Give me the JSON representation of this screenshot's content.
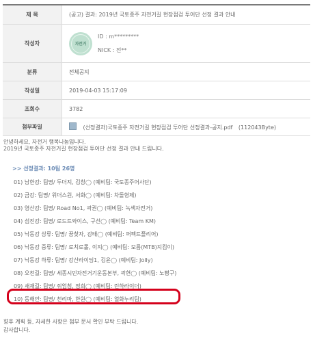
{
  "meta": {
    "title_label": "제 목",
    "title_value": "(공고) 결과: 2019년 국토종주 자전거길 현장점검 투어단 선정 결과 안내",
    "author_label": "작성자",
    "author_avatar_text": "자전거",
    "author_id": "ID : m*********",
    "author_nick": "NICK : 전**",
    "category_label": "분류",
    "category_value": "전체공지",
    "date_label": "작성일",
    "date_value": "2019-04-03 15:17:09",
    "views_label": "조회수",
    "views_value": "3782",
    "attach_label": "첨부파일",
    "attach_name": "(선정결과)국토종주 자전거길 현장점검 투어단 선정결과-공지.pdf",
    "attach_size": "(112043Byte)"
  },
  "body": {
    "greeting": "안녕하세요, 자전거 행복나눔입니다.",
    "intro": "2019년 국토종주 자전거길 현장점검 투어단 선정 결과 안내 드립니다.",
    "result_heading": ">> 선정결과: 10팀 26명",
    "items": [
      "01) 남한강: 팀명/ 두더지, 김창◯ (예비팀: 국토종주어사단)",
      "02) 금강: 팀명/ 위더스원, 서화◯ (예비팀: 차돌형제)",
      "03) 영산강: 팀명/ Road No1, 곽권◯ (예비팀: 녹색자전거)",
      "04) 섬진강: 팀명/ 로드트와이스, 구선◯ (예비팀: Team KM)",
      "05) 낙동강 상류: 팀명/ 꿈찾자, 강태◯ (예비팀: 퍼펙트플리어)",
      "06) 낙동강 중류: 팀명/ 로치로롤, 이지◯ (예비팀: 모름(MTB)지킴이)",
      "07) 낙동강 하류: 팀명/ 강산라이딩1, 김윤◯ (예비팀: Jolly)",
      "08) 오천길: 팀명/ 세종시민자전거기운동본부, 곽현◯ (예비팀: 노빵구)",
      "09) 새재길: 팀명/ 쥐엄청, 정희◯ (예비팀: 린하라이더)",
      "10) 동해안: 팀명/ 천리마, 한원◯ (예비팀: 열화누리팀)"
    ],
    "closing1": "향후 계획 등, 자세한 사항은 첨부 문서 확인 부탁 드립니다.",
    "closing2": "감사합니다."
  },
  "colors": {
    "highlight": "#d4001b",
    "heading": "#6b8bb5"
  }
}
